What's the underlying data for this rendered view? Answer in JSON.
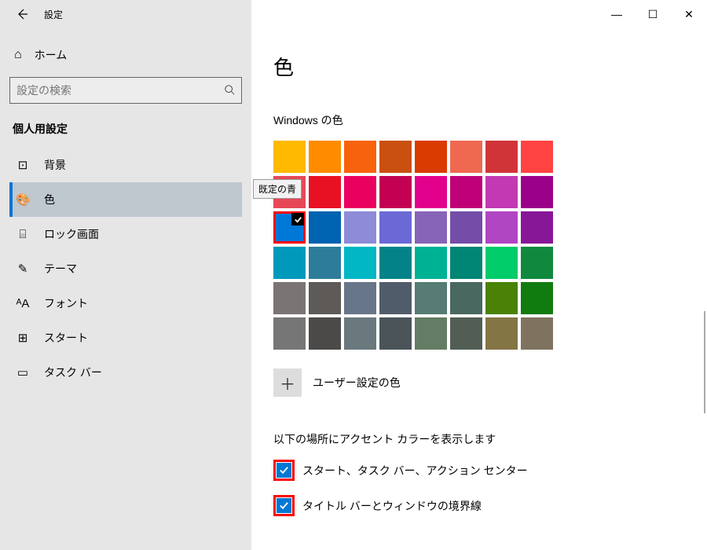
{
  "window": {
    "title": "設定",
    "controls": {
      "minimize": "—",
      "maximize": "☐",
      "close": "✕"
    }
  },
  "sidebar": {
    "home": "ホーム",
    "search_placeholder": "設定の検索",
    "section": "個人用設定",
    "items": [
      {
        "icon": "⊡",
        "label": "背景",
        "selected": false
      },
      {
        "icon": "🎨",
        "label": "色",
        "selected": true
      },
      {
        "icon": "⌸",
        "label": "ロック画面",
        "selected": false
      },
      {
        "icon": "✎",
        "label": "テーマ",
        "selected": false
      },
      {
        "icon": "ᴬA",
        "label": "フォント",
        "selected": false
      },
      {
        "icon": "⊞",
        "label": "スタート",
        "selected": false
      },
      {
        "icon": "▭",
        "label": "タスク バー",
        "selected": false
      }
    ]
  },
  "content": {
    "heading": "色",
    "palette_label": "Windows の色",
    "tooltip_text": "既定の青",
    "palette": [
      [
        "#ffb900",
        "#ff8c00",
        "#f7630c",
        "#ca5010",
        "#da3b01",
        "#ef6950",
        "#d13438",
        "#ff4343"
      ],
      [
        "#e74856",
        "#e81123",
        "#ea005e",
        "#c30052",
        "#e3008c",
        "#bf0077",
        "#c239b3",
        "#9a0089"
      ],
      [
        "#0078d7",
        "#0063b1",
        "#8e8cd8",
        "#6b69d6",
        "#8764b8",
        "#744da9",
        "#b146c2",
        "#881798"
      ],
      [
        "#0099bc",
        "#2d7d9a",
        "#00b7c3",
        "#038387",
        "#00b294",
        "#018574",
        "#00cc6a",
        "#10893e"
      ],
      [
        "#7a7574",
        "#5d5a58",
        "#68768a",
        "#515c6b",
        "#567c73",
        "#486860",
        "#498205",
        "#107c10"
      ],
      [
        "#767676",
        "#4c4a48",
        "#69797e",
        "#4a5459",
        "#647c64",
        "#525e54",
        "#847545",
        "#7e735f"
      ]
    ],
    "selected_swatch": [
      2,
      0
    ],
    "custom_color_label": "ユーザー設定の色",
    "accent_section_label": "以下の場所にアクセント カラーを表示します",
    "checkboxes": [
      {
        "label": "スタート、タスク バー、アクション センター",
        "checked": true
      },
      {
        "label": "タイトル バーとウィンドウの境界線",
        "checked": true
      }
    ]
  }
}
